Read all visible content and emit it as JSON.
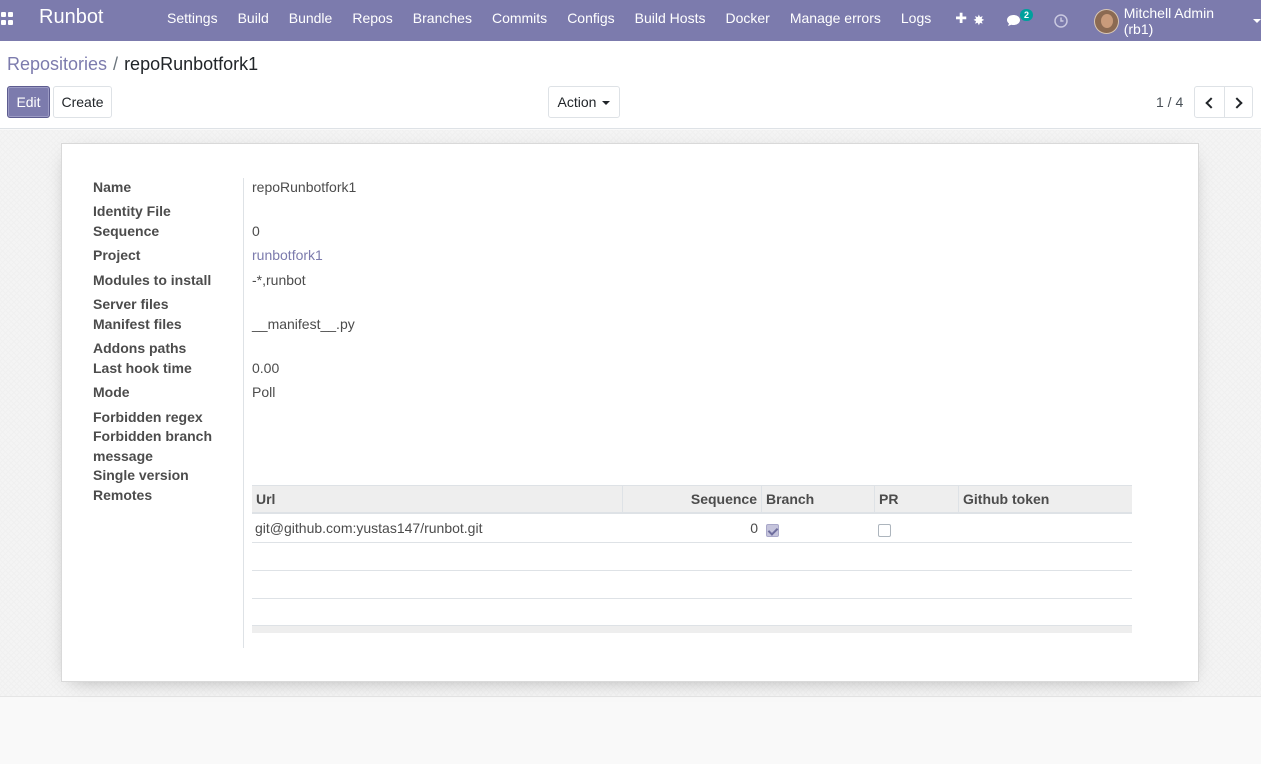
{
  "navbar": {
    "brand": "Runbot",
    "menu": [
      "Settings",
      "Build",
      "Bundle",
      "Repos",
      "Branches",
      "Commits",
      "Configs",
      "Build Hosts",
      "Docker",
      "Manage errors",
      "Logs"
    ],
    "plus": "✚",
    "bug": "✸",
    "chat": "💬",
    "clock": "◷",
    "messages_count": "2",
    "user": "Mitchell Admin (rb1)",
    "icons": {
      "apps": "apps-grid-icon",
      "plus": "plus-icon",
      "bug": "bug-icon",
      "chat": "chat-icon",
      "clock": "clock-icon"
    }
  },
  "breadcrumb": {
    "parent": "Repositories",
    "separator": "/",
    "current": "repoRunbotfork1"
  },
  "buttons": {
    "edit": "Edit",
    "create": "Create",
    "action": "Action"
  },
  "pager": {
    "value": "1 / 4"
  },
  "form": {
    "name_label": "Name",
    "name": "repoRunbotfork1",
    "identity_label": "Identity File",
    "sequence_label": "Sequence",
    "sequence": "0",
    "project_label": "Project",
    "project": "runbotfork1",
    "modules_label": "Modules to install",
    "modules": "-*,runbot",
    "server_files_label": "Server files",
    "manifest_label": "Manifest files",
    "manifest": "__manifest__.py",
    "addons_label": "Addons paths",
    "hook_label": "Last hook time",
    "hook": "0.00",
    "mode_label": "Mode",
    "mode": "Poll",
    "forbidden_regex_label": "Forbidden regex",
    "forbidden_msg_label_1": "Forbidden branch",
    "forbidden_msg_label_2": "message",
    "single_version_label": "Single version",
    "remotes_label": "Remotes"
  },
  "remotes": {
    "headers": {
      "url": "Url",
      "sequence": "Sequence",
      "branch": "Branch",
      "pr": "PR",
      "token": "Github token"
    },
    "rows": [
      {
        "url": "git@github.com:yustas147/runbot.git",
        "sequence": "0",
        "branch": true,
        "pr": false,
        "token": ""
      }
    ]
  },
  "colors": {
    "primary": "#7c7bad",
    "badge": "#00a09d"
  }
}
